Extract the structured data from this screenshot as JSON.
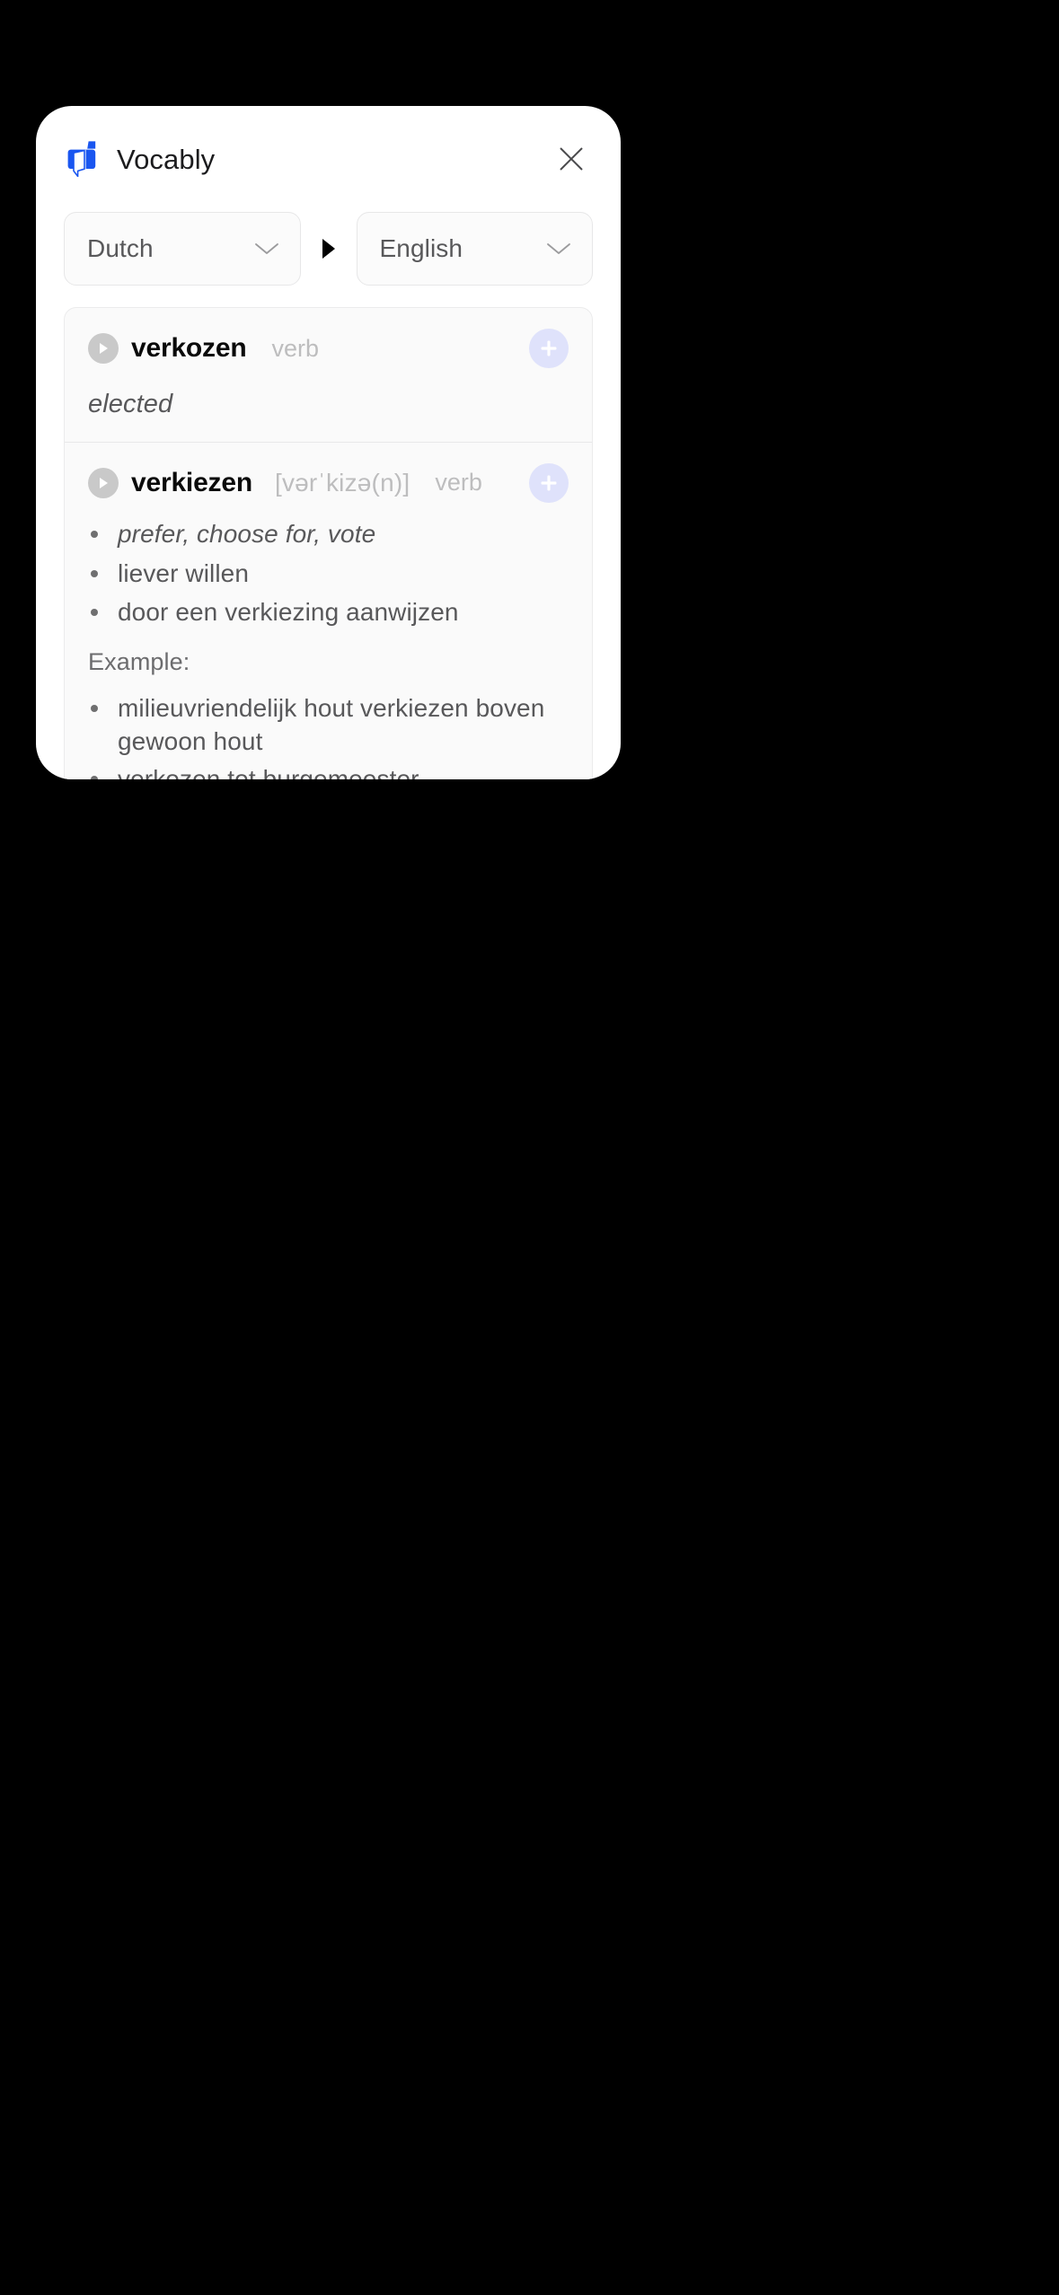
{
  "app": {
    "title": "Vocably",
    "brand_color": "#1a56f0",
    "close_label": "×"
  },
  "language_bar": {
    "source": {
      "value": "Dutch",
      "icon": "chevron-down-icon"
    },
    "direction_icon": "play-triangle-icon",
    "target": {
      "value": "English",
      "icon": "chevron-down-icon"
    }
  },
  "results": [
    {
      "headword": "verkozen",
      "ipa": "",
      "pos": "verb",
      "play_icon": "play-icon",
      "add_icon": "plus-icon",
      "meaning": "elected",
      "meanings": [],
      "example_label": "",
      "examples": []
    },
    {
      "headword": "verkiezen",
      "ipa": "[vərˈkizə(n)]",
      "pos": "verb",
      "play_icon": "play-icon",
      "add_icon": "plus-icon",
      "meaning": "",
      "meanings": [
        {
          "text": "prefer, choose for, vote",
          "italic": true
        },
        {
          "text": "liever willen",
          "italic": false
        },
        {
          "text": "door een verkiezing aanwijzen",
          "italic": false
        }
      ],
      "example_label": "Example:",
      "examples": [
        "milieuvriendelijk hout verkiezen boven gewoon hout",
        "verkozen tot burgemeester"
      ]
    }
  ],
  "colors": {
    "background": "#000000",
    "card": "#ffffff",
    "panel": "#fafafa",
    "add_button": "#dfe2fb",
    "play_button": "#c9c9c9",
    "muted_text": "#bdbdbe",
    "body_text": "#58585a"
  }
}
